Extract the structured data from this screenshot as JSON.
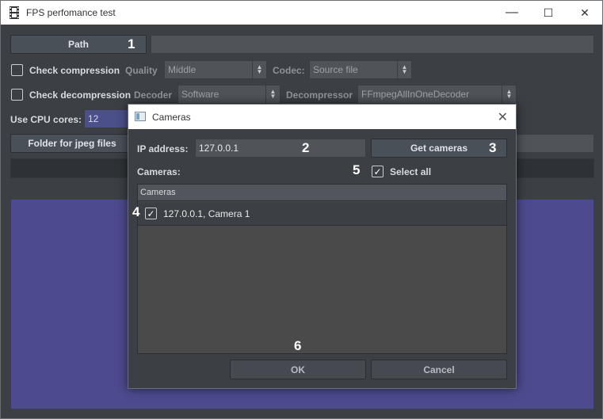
{
  "window": {
    "title": "FPS perfomance test",
    "minimize_glyph": "—",
    "maximize_glyph": "☐",
    "close_glyph": "✕"
  },
  "main": {
    "path_button": "Path",
    "path_value": "",
    "check_compression": "Check compression",
    "quality_label": "Quality",
    "quality_value": "Middle",
    "codec_label": "Codec:",
    "codec_value": "Source file",
    "check_decompression": "Check decompression",
    "decoder_label": "Decoder",
    "decoder_value": "Software",
    "decompressor_label": "Decompressor",
    "decompressor_value": "FFmpegAllInOneDecoder",
    "cpu_cores_label": "Use CPU cores:",
    "cpu_cores_value": "12",
    "jpeg_folder_button": "Folder for jpeg files"
  },
  "dialog": {
    "title": "Cameras",
    "close_glyph": "✕",
    "ip_label": "IP address:",
    "ip_value": "127.0.0.1",
    "get_cameras_button": "Get cameras",
    "cameras_label": "Cameras:",
    "select_all_label": "Select all",
    "select_all_checked": true,
    "table_header": "Cameras",
    "cameras": [
      {
        "label": "127.0.0.1, Camera 1",
        "checked": true
      }
    ],
    "ok_button": "OK",
    "cancel_button": "Cancel"
  },
  "annotations": [
    "1",
    "2",
    "3",
    "4",
    "5",
    "6"
  ],
  "colors": {
    "background": "#3c3f44",
    "panel_accent": "#4d4b8f",
    "cpu_field": "#4b4f8a"
  }
}
